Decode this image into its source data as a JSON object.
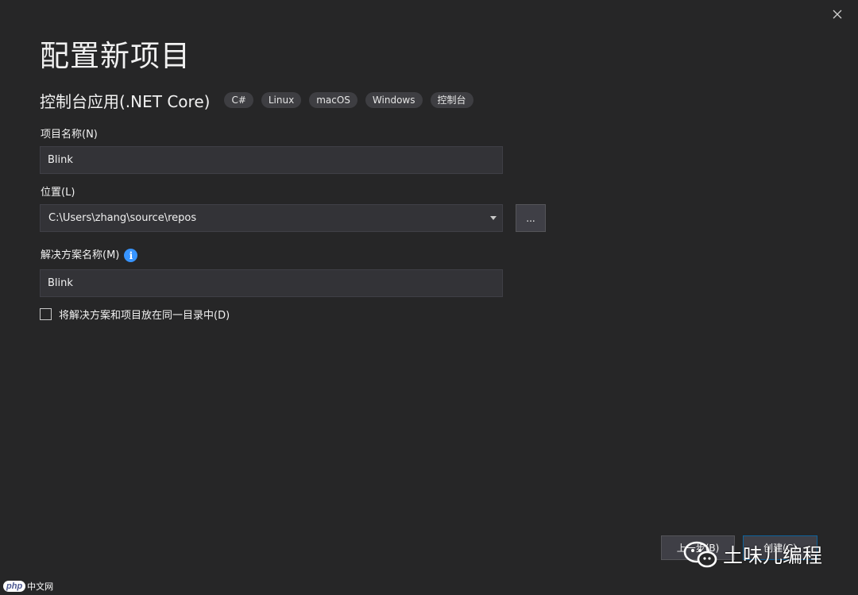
{
  "dialog": {
    "title": "配置新项目",
    "template_name": "控制台应用(.NET Core)",
    "tags": [
      "C#",
      "Linux",
      "macOS",
      "Windows",
      "控制台"
    ]
  },
  "project_name": {
    "label": "项目名称(N)",
    "value": "Blink"
  },
  "location": {
    "label": "位置(L)",
    "value": "C:\\Users\\zhang\\source\\repos",
    "browse_label": "..."
  },
  "solution_name": {
    "label": "解决方案名称(M)",
    "info_glyph": "i",
    "value": "Blink"
  },
  "same_directory": {
    "label": "将解决方案和项目放在同一目录中(D)",
    "checked": false
  },
  "footer": {
    "back_label": "上一步(B)",
    "create_label": "创建(C)"
  },
  "watermarks": {
    "wechat_text": "土味儿编程",
    "php_logo": "php",
    "php_site": "中文网"
  },
  "icons": {
    "close": "close-icon",
    "dropdown": "chevron-down-icon",
    "info": "info-icon",
    "wechat": "wechat-icon"
  },
  "colors": {
    "background": "#262627",
    "input_bg": "#333337",
    "tag_bg": "#3e3e42",
    "accent": "#3794ff",
    "primary_border": "#0e639c"
  }
}
